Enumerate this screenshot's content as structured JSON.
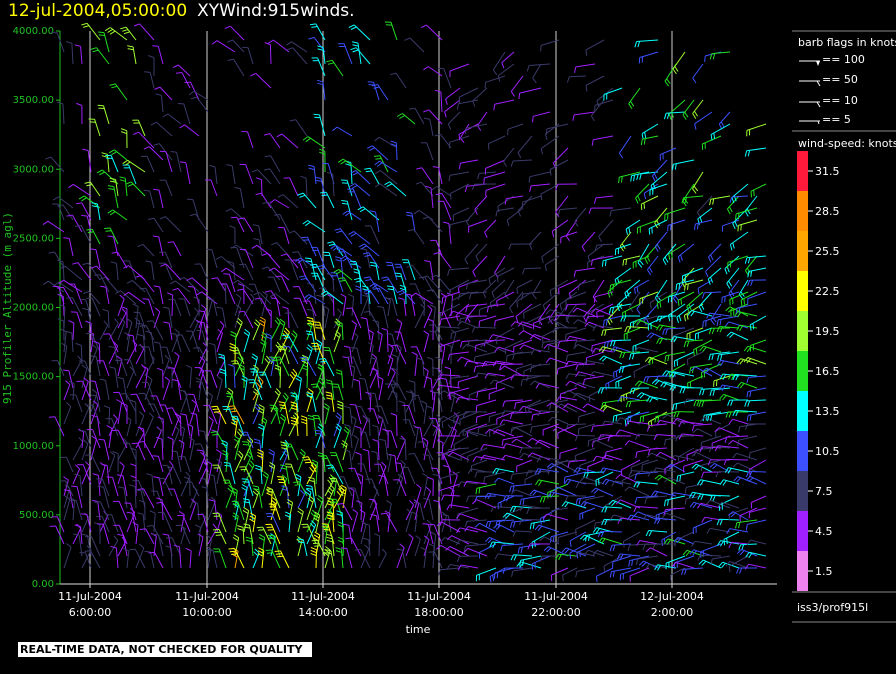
{
  "header": {
    "datetime": "12-jul-2004,05:00:00",
    "product": "XYWind:915winds."
  },
  "chart_data": {
    "type": "wind-barb time-height plot",
    "ylabel": "915 Profiler Altitude (m agl)",
    "xlabel": "time",
    "ylim": [
      0,
      4000
    ],
    "y_ticks": [
      "0.00",
      "500.00",
      "1000.00",
      "1500.00",
      "2000.00",
      "2500.00",
      "3000.00",
      "3500.00",
      "4000.00"
    ],
    "x_ticks": [
      {
        "date": "11-Jul-2004",
        "time": "6:00:00"
      },
      {
        "date": "11-Jul-2004",
        "time": "10:00:00"
      },
      {
        "date": "11-Jul-2004",
        "time": "14:00:00"
      },
      {
        "date": "11-Jul-2004",
        "time": "18:00:00"
      },
      {
        "date": "11-Jul-2004",
        "time": "22:00:00"
      },
      {
        "date": "12-Jul-2004",
        "time": "2:00:00"
      }
    ],
    "grid": "vertical lines at each time tick",
    "barb_legend": {
      "title": "barb flags in knots",
      "entries": [
        "== 100",
        "== 50",
        "== 10",
        "== 5"
      ]
    },
    "speed_legend": {
      "title": "wind-speed: knots",
      "bins": [
        {
          "value": "31.5",
          "color": "#ff1a3c"
        },
        {
          "value": "28.5",
          "color": "#ff8c00"
        },
        {
          "value": "25.5",
          "color": "#ffa500"
        },
        {
          "value": "22.5",
          "color": "#ffff00"
        },
        {
          "value": "19.5",
          "color": "#a0ff30"
        },
        {
          "value": "16.5",
          "color": "#20e020"
        },
        {
          "value": "13.5",
          "color": "#00ffff"
        },
        {
          "value": "10.5",
          "color": "#3c50ff"
        },
        {
          "value": "7.5",
          "color": "#3a3a6a"
        },
        {
          "value": "4.5",
          "color": "#a020ff"
        },
        {
          "value": "1.5",
          "color": "#ee82ee"
        }
      ]
    }
  },
  "station_id": "iss3/prof915l",
  "footer_note": "REAL-TIME DATA, NOT CHECKED FOR QUALITY"
}
